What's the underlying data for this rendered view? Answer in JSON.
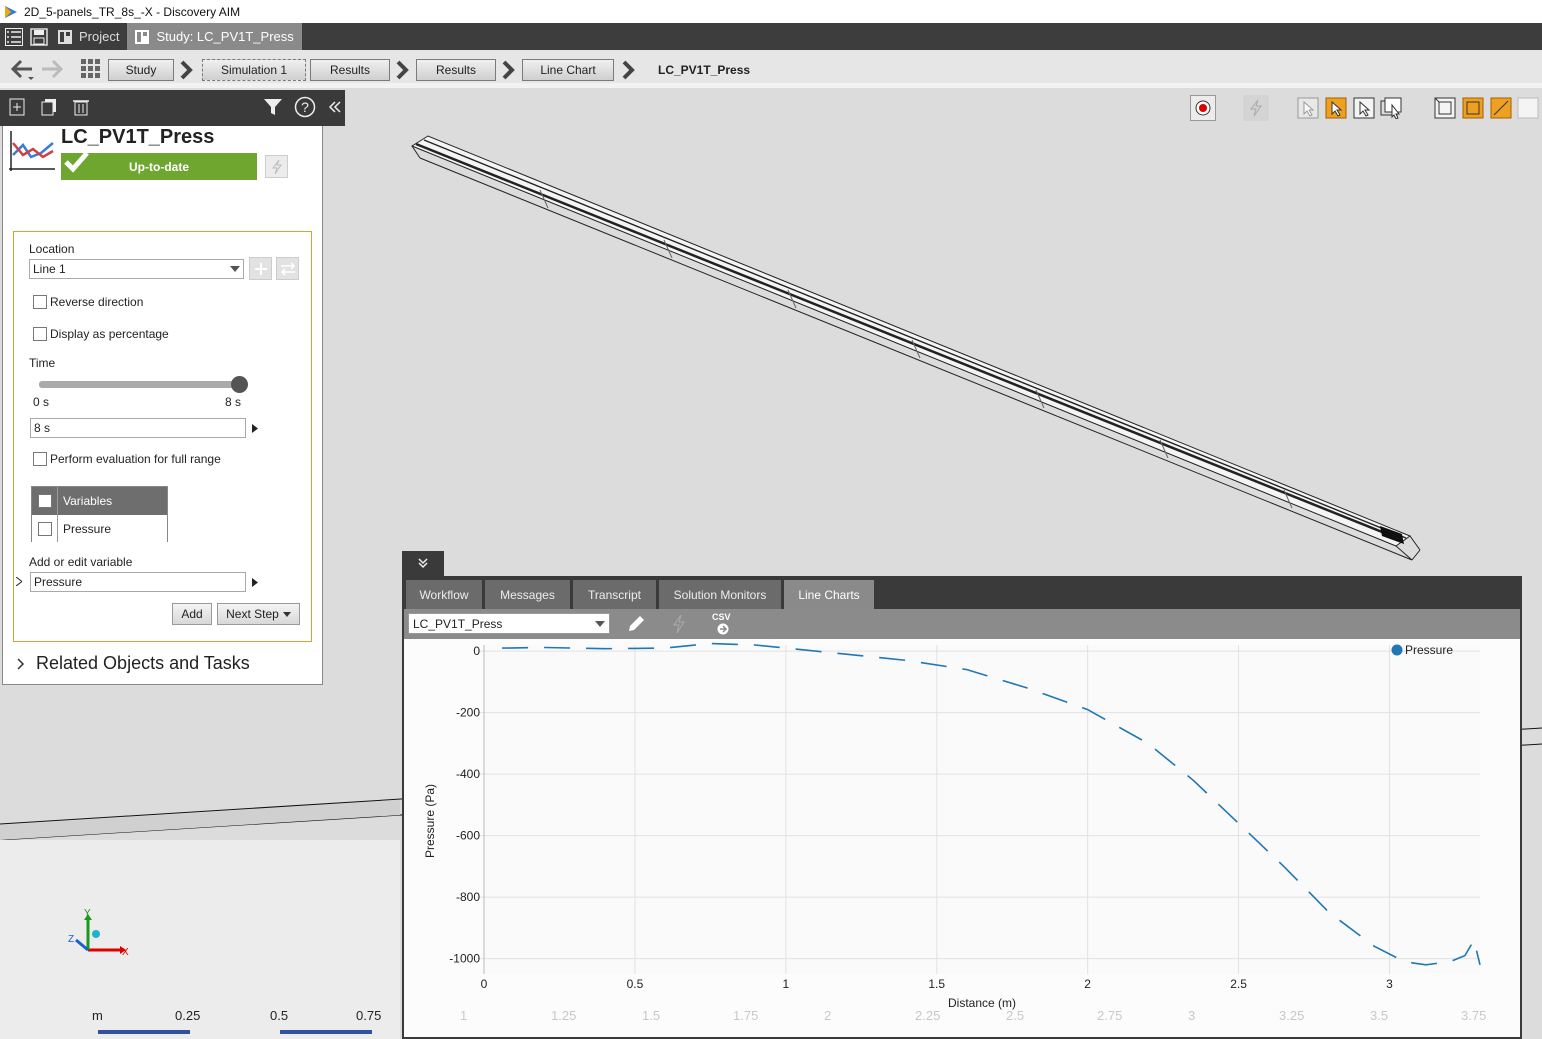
{
  "window": {
    "title": "2D_5-panels_TR_8s_-X - Discovery AIM"
  },
  "topbar": {
    "tabs": [
      {
        "label": "Project"
      },
      {
        "label": "Study: LC_PV1T_Press"
      }
    ]
  },
  "breadcrumb": {
    "items": [
      "Study",
      "Simulation 1",
      "Results",
      "Results",
      "Line Chart"
    ],
    "current": "LC_PV1T_Press"
  },
  "panel": {
    "title": "LC_PV1T_Press",
    "status": "Up-to-date",
    "location_label": "Location",
    "location_value": "Line 1",
    "reverse_label": "Reverse direction",
    "percentage_label": "Display as percentage",
    "time_label": "Time",
    "time_min": "0 s",
    "time_max": "8 s",
    "time_value": "8 s",
    "time_fraction": 1.0,
    "full_range_label": "Perform evaluation for full range",
    "variables_header": "Variables",
    "variables": [
      "Pressure"
    ],
    "edit_var_label": "Add or edit variable",
    "edit_var_value": "Pressure",
    "add_button": "Add",
    "next_button": "Next Step",
    "related": "Related Objects and Tasks"
  },
  "chartpanel": {
    "tabs": [
      "Workflow",
      "Messages",
      "Transcript",
      "Solution Monitors",
      "Line Charts"
    ],
    "active_tab": "Line Charts",
    "selected_chart": "LC_PV1T_Press",
    "csv_label": "CSV"
  },
  "chart_data": {
    "type": "line",
    "xlabel": "Distance (m)",
    "ylabel": "Pressure (Pa)",
    "xlim": [
      0,
      3.3
    ],
    "ylim": [
      -1050,
      20
    ],
    "xticks": [
      0,
      0.5,
      1,
      1.5,
      2,
      2.5,
      3
    ],
    "yticks": [
      0,
      -200,
      -400,
      -600,
      -800,
      -1000
    ],
    "legend_position": "top-right",
    "series": [
      {
        "name": "Pressure",
        "color": "#1f77b4",
        "x": [
          0.06,
          0.2,
          0.4,
          0.6,
          0.75,
          0.9,
          1.0,
          1.2,
          1.4,
          1.6,
          1.8,
          2.0,
          2.2,
          2.35,
          2.5,
          2.65,
          2.8,
          2.95,
          3.05,
          3.12,
          3.2,
          3.25,
          3.28,
          3.3
        ],
        "y": [
          10,
          12,
          8,
          10,
          25,
          20,
          10,
          -10,
          -30,
          -60,
          -120,
          -190,
          -300,
          -420,
          -560,
          -700,
          -850,
          -960,
          -1010,
          -1020,
          -1010,
          -990,
          -940,
          -1020
        ]
      }
    ]
  },
  "ruler": {
    "unit": "m",
    "labels": [
      "0.25",
      "0.5",
      "0.75"
    ],
    "faint_labels": [
      "1",
      "1.25",
      "1.5",
      "1.75",
      "2",
      "2.25",
      "2.5",
      "2.75",
      "3",
      "3.25",
      "3.5",
      "3.75"
    ]
  },
  "axis_triad": {
    "x": "X",
    "y": "Y",
    "z": "Z"
  },
  "colors": {
    "accent_green": "#6fa630",
    "orange": "#e0a030",
    "dark": "#3a3a3a",
    "series": "#1f77b4"
  }
}
